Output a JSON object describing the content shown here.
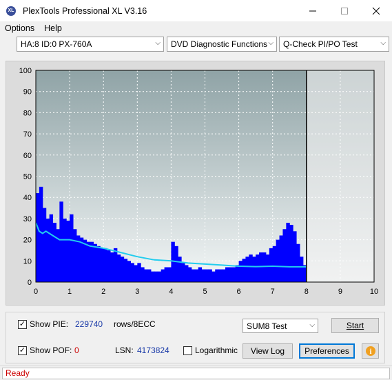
{
  "window": {
    "title": "PlexTools Professional XL V3.16",
    "icon_text": "XL"
  },
  "menu": {
    "options": "Options",
    "help": "Help"
  },
  "toolbar": {
    "drive": "HA:8 ID:0  PX-760A",
    "function": "DVD Diagnostic Functions",
    "test": "Q-Check PI/PO Test"
  },
  "chart_data": {
    "type": "bar",
    "xlim": [
      0,
      10
    ],
    "ylim": [
      0,
      100
    ],
    "x_ticks": [
      "0",
      "1",
      "2",
      "3",
      "4",
      "5",
      "6",
      "7",
      "8",
      "9",
      "10"
    ],
    "y_ticks": [
      "0",
      "10",
      "20",
      "30",
      "40",
      "50",
      "60",
      "70",
      "80",
      "90",
      "100"
    ],
    "end_marker_x": 8.0,
    "grid": true,
    "series": [
      {
        "kind": "bars",
        "color": "#0000ff",
        "x": [
          0.0,
          0.1,
          0.2,
          0.3,
          0.4,
          0.5,
          0.6,
          0.7,
          0.8,
          0.9,
          1.0,
          1.1,
          1.2,
          1.3,
          1.4,
          1.5,
          1.6,
          1.7,
          1.8,
          1.9,
          2.0,
          2.1,
          2.2,
          2.3,
          2.4,
          2.5,
          2.6,
          2.7,
          2.8,
          2.9,
          3.0,
          3.1,
          3.2,
          3.3,
          3.4,
          3.5,
          3.6,
          3.7,
          3.8,
          3.9,
          4.0,
          4.1,
          4.2,
          4.3,
          4.4,
          4.5,
          4.6,
          4.7,
          4.8,
          4.9,
          5.0,
          5.1,
          5.2,
          5.3,
          5.4,
          5.5,
          5.6,
          5.7,
          5.8,
          5.9,
          6.0,
          6.1,
          6.2,
          6.3,
          6.4,
          6.5,
          6.6,
          6.7,
          6.8,
          6.9,
          7.0,
          7.1,
          7.2,
          7.3,
          7.4,
          7.5,
          7.6,
          7.7,
          7.8,
          7.9
        ],
        "values": [
          42,
          45,
          35,
          30,
          32,
          28,
          25,
          38,
          30,
          29,
          32,
          25,
          22,
          21,
          20,
          19,
          19,
          18,
          17,
          16,
          16,
          15,
          14,
          16,
          13,
          12,
          11,
          10,
          9,
          8,
          9,
          7,
          6,
          6,
          5,
          5,
          5,
          6,
          7,
          7,
          19,
          17,
          12,
          9,
          8,
          7,
          6,
          6,
          7,
          6,
          6,
          6,
          5,
          6,
          6,
          6,
          7,
          7,
          7,
          8,
          10,
          11,
          12,
          13,
          12,
          13,
          14,
          14,
          13,
          16,
          17,
          20,
          22,
          25,
          28,
          27,
          24,
          18,
          12,
          8
        ]
      },
      {
        "kind": "line",
        "color": "#22ccee",
        "x": [
          0.0,
          0.1,
          0.2,
          0.3,
          0.4,
          0.5,
          0.7,
          1.0,
          1.3,
          1.6,
          2.0,
          2.5,
          3.0,
          3.5,
          4.0,
          4.5,
          5.0,
          5.5,
          6.0,
          6.5,
          7.0,
          7.5,
          8.0
        ],
        "values": [
          28,
          24,
          23,
          24,
          23,
          22,
          20,
          20,
          19,
          17,
          16,
          14,
          12,
          10.5,
          10,
          9,
          8.5,
          8,
          7.5,
          7.3,
          7.5,
          7.2,
          7.2
        ]
      }
    ]
  },
  "panel": {
    "show_pie_label": "Show PIE:",
    "pie_value": "229740",
    "pie_unit": "rows/8ECC",
    "show_pof_label": "Show POF:",
    "pof_value": "0",
    "lsn_label": "LSN:",
    "lsn_value": "4173824",
    "logarithmic_label": "Logarithmic",
    "test_select": "SUM8 Test",
    "start_label": "Start",
    "view_log_label": "View Log",
    "preferences_label": "Preferences"
  },
  "status": {
    "text": "Ready",
    "color": "#cc0000"
  }
}
